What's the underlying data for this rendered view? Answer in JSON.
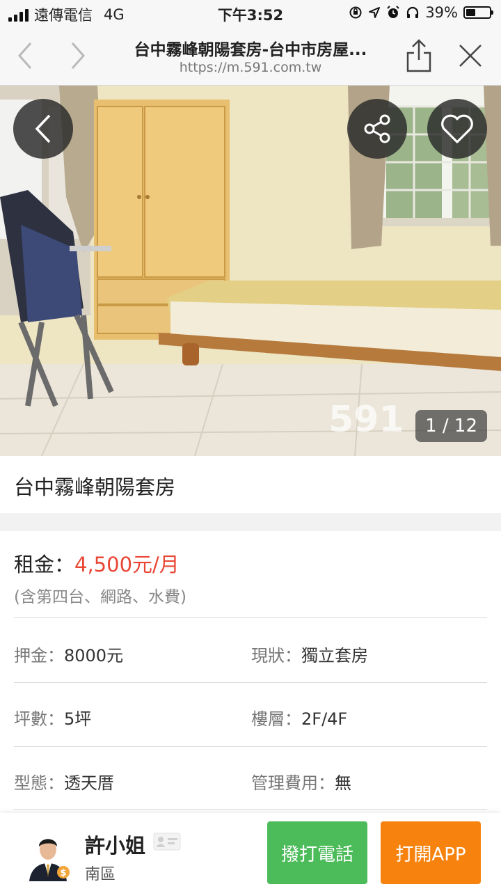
{
  "status_bar": {
    "carrier": "遠傳電信",
    "network": "4G",
    "time": "下午3:52",
    "battery": "39%",
    "icons": [
      "signal-icon",
      "rotation-lock-icon",
      "location-icon",
      "alarm-icon",
      "headphones-icon",
      "battery-icon"
    ]
  },
  "browser": {
    "title": "台中霧峰朝陽套房-台中市房屋...",
    "url": "https://m.591.com.tw",
    "icons": [
      "back-chevron-icon",
      "forward-chevron-icon",
      "share-icon",
      "close-icon"
    ]
  },
  "gallery": {
    "counter": "1 / 12",
    "watermark": "591",
    "icons": [
      "back-arrow-icon",
      "share-icon",
      "heart-icon"
    ]
  },
  "listing": {
    "title": "台中霧峰朝陽套房",
    "rent_label": "租金：",
    "rent_value": "4,500元/月",
    "rent_note": "(含第四台、網路、水費)",
    "details": [
      {
        "key": "押金：",
        "value": "8000元"
      },
      {
        "key": "現狀：",
        "value": "獨立套房"
      },
      {
        "key": "坪數：",
        "value": "5坪"
      },
      {
        "key": "樓層：",
        "value": "2F/4F"
      },
      {
        "key": "型態：",
        "value": "透天厝"
      },
      {
        "key": "管理費用：",
        "value": "無"
      }
    ]
  },
  "contact": {
    "name": "許小姐",
    "area": "南區",
    "call_button": "撥打電話",
    "app_button": "打開APP"
  },
  "colors": {
    "price": "#e94634",
    "call_button": "#4cbb5a",
    "app_button": "#f7830e"
  }
}
